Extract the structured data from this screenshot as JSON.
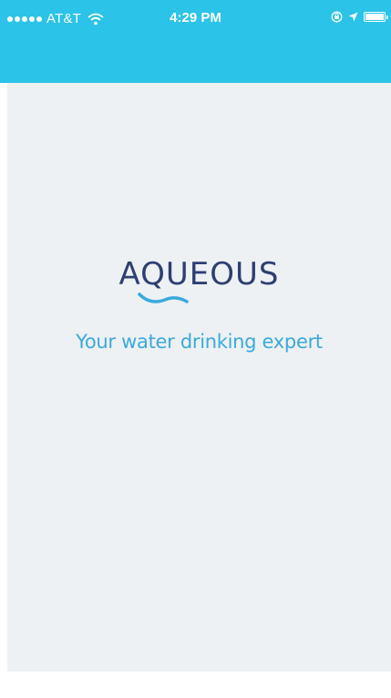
{
  "status_bar": {
    "carrier": "AT&T",
    "time": "4:29 PM",
    "signal_dots": 5,
    "icons": [
      "wifi-icon",
      "lock-rotation-icon",
      "location-icon",
      "battery-icon"
    ]
  },
  "branding": {
    "logo_text": "AQUEOUS",
    "tagline": "Your water drinking expert"
  },
  "colors": {
    "header": "#2bc3e8",
    "background": "#eef1f4",
    "logo": "#2d3f73",
    "tagline": "#3aa9de"
  }
}
